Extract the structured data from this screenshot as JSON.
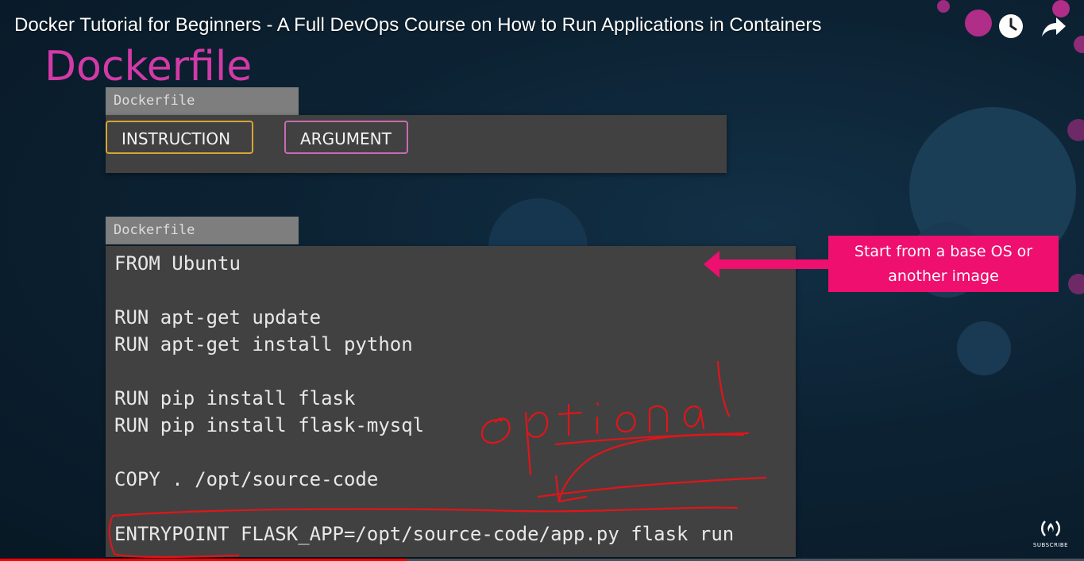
{
  "video": {
    "title": "Docker Tutorial for Beginners - A Full DevOps Course on How to Run Applications in Containers",
    "watch_later_icon": "clock-icon",
    "share_icon": "share-arrow-icon",
    "progress": 0.375
  },
  "slide": {
    "title": "Dockerfile",
    "format_panel": {
      "tab_label": "Dockerfile",
      "instruction_label": "INSTRUCTION",
      "argument_label": "ARGUMENT"
    },
    "code_panel": {
      "tab_label": "Dockerfile",
      "lines": [
        "FROM Ubuntu",
        "RUN apt-get update",
        "RUN apt-get install python",
        "RUN pip install flask",
        "RUN pip install flask-mysql",
        "COPY . /opt/source-code",
        "ENTRYPOINT FLASK_APP=/opt/source-code/app.py flask run"
      ]
    },
    "callout": {
      "line1": "Start from a base OS or",
      "line2": "another image"
    },
    "handwritten_note": "optional"
  },
  "channel_badge": {
    "logo": "(ʌ)",
    "label": "SUBSCRIBE"
  },
  "colors": {
    "title_magenta": "#d23aa7",
    "instruction_border": "#d8a532",
    "argument_border": "#c96bb3",
    "callout_pink": "#ee0f6f",
    "annotation_red": "#e0151a",
    "progress_red": "#ff0000"
  }
}
